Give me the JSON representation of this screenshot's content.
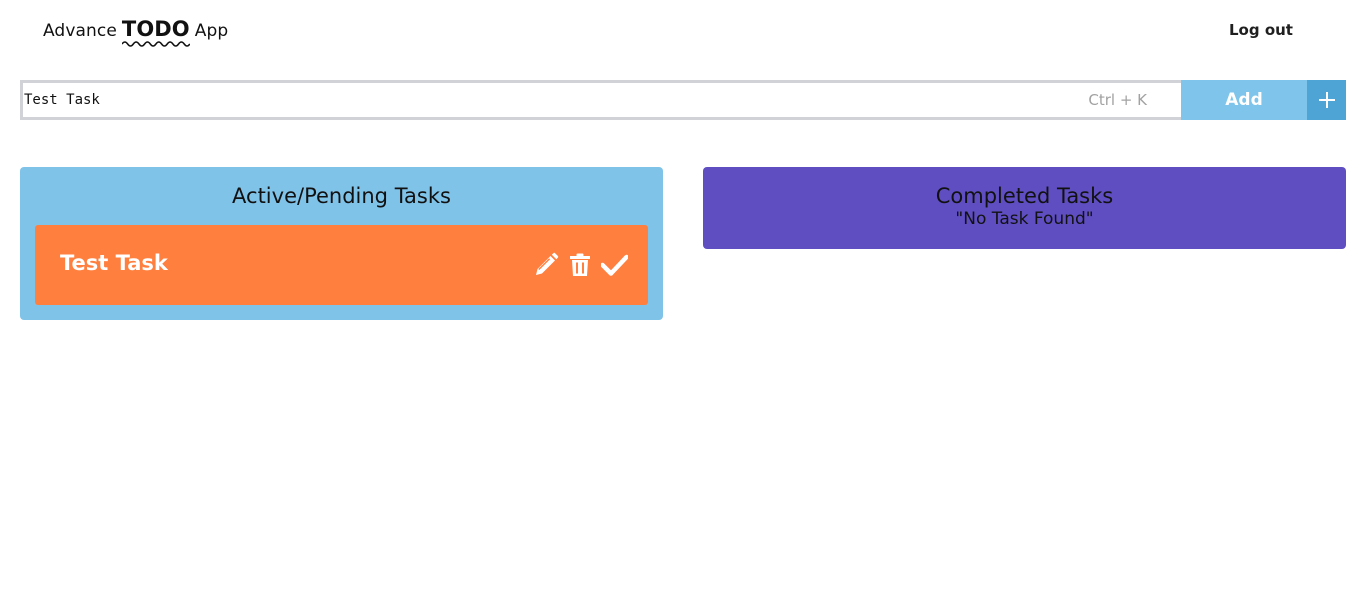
{
  "header": {
    "brand_prefix": "Advance",
    "brand_highlight": "TODO",
    "brand_suffix": "App",
    "logout_label": "Log out"
  },
  "task_input": {
    "value": "Test Task",
    "shortcut_hint": "Ctrl + K",
    "add_label": "Add",
    "plus_icon": "plus-icon"
  },
  "active_panel": {
    "title": "Active/Pending Tasks",
    "tasks": [
      {
        "text": "Test Task",
        "actions": [
          "pencil-icon",
          "trash-icon",
          "check-icon"
        ]
      }
    ]
  },
  "completed_panel": {
    "title": "Completed Tasks",
    "empty_message": "\"No Task Found\""
  },
  "colors": {
    "input_border": "#d1d2d7",
    "add_button": "#7fc4ea",
    "plus_button": "#4ea4d4",
    "active_panel": "#80c3e9",
    "task_card": "#ff7f3f",
    "completed_panel": "#5f4ec2"
  }
}
